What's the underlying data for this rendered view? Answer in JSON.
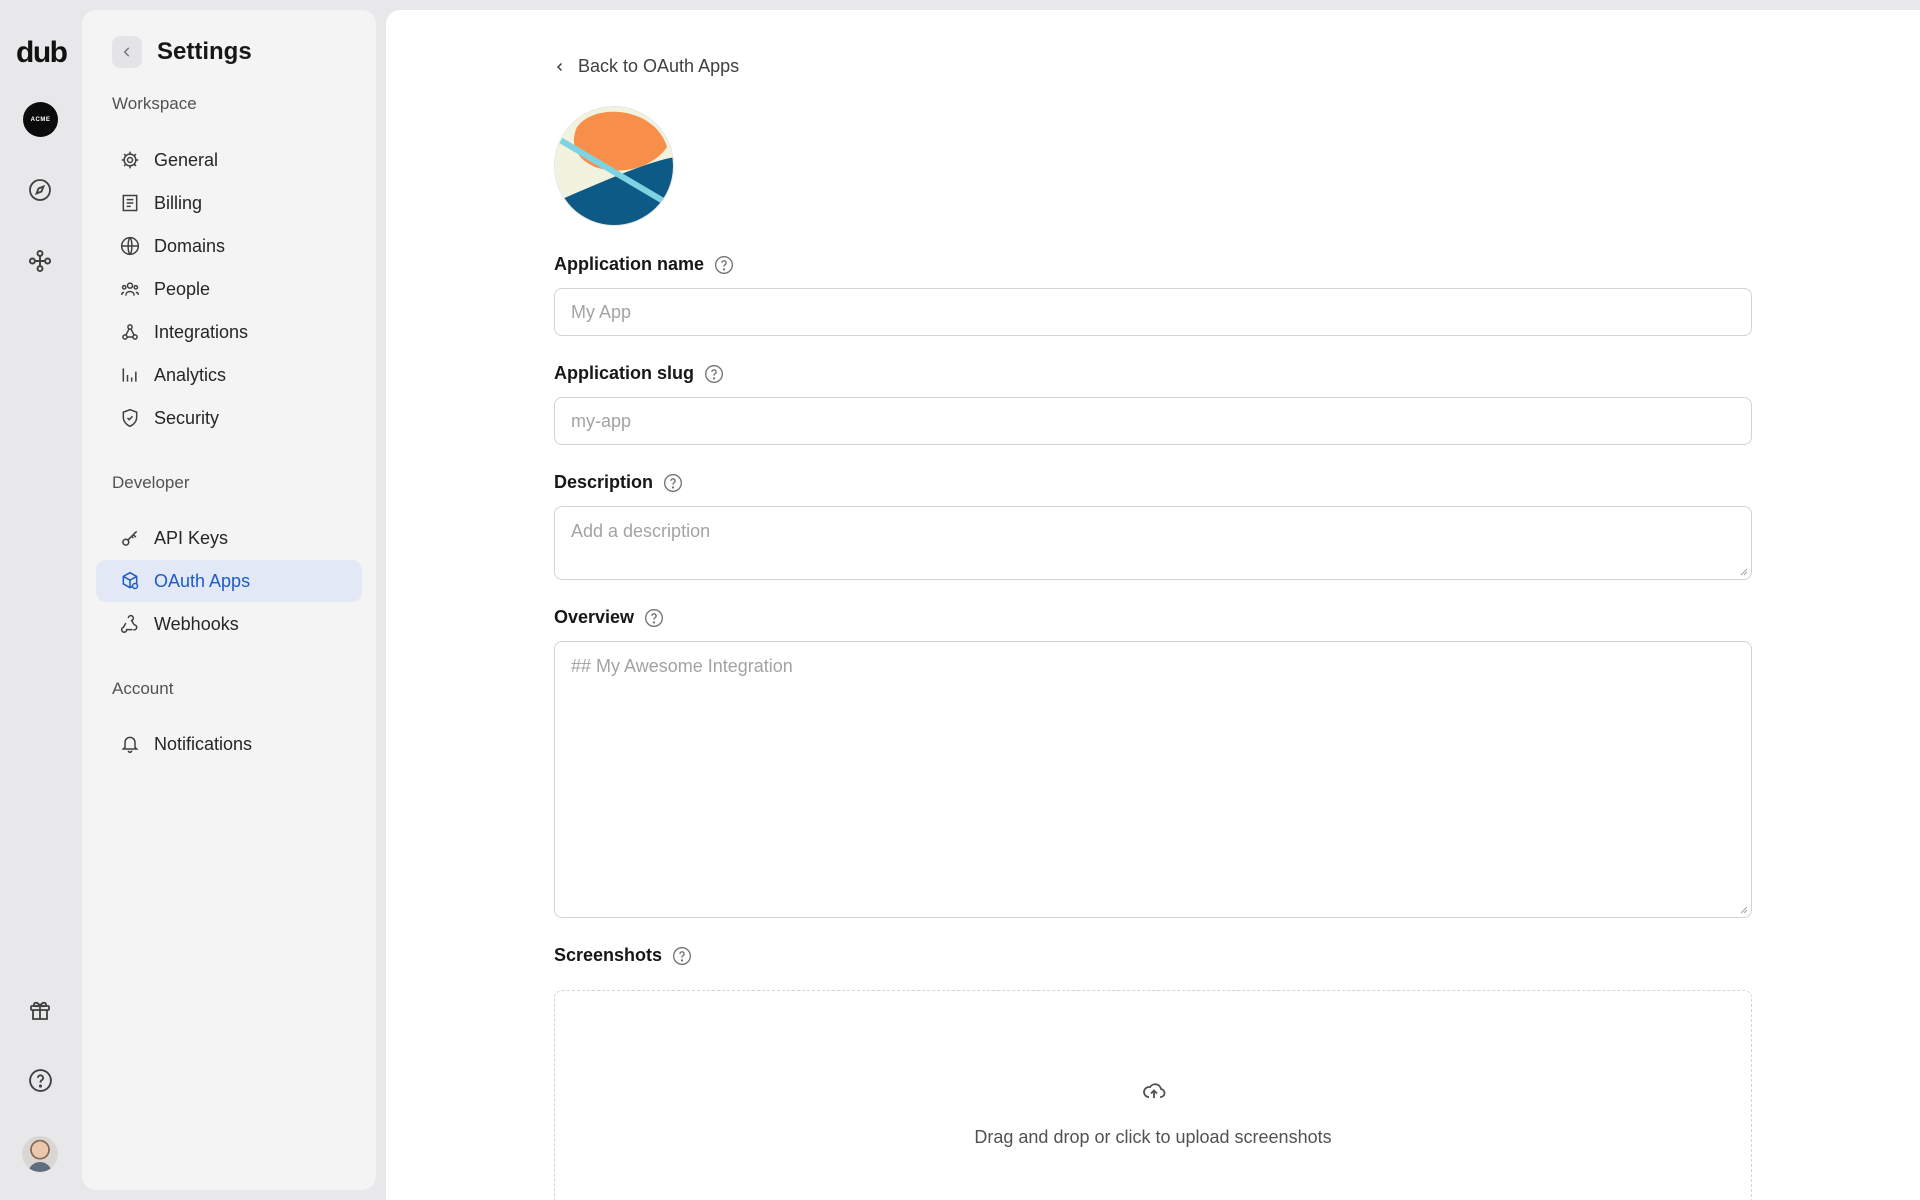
{
  "rail": {
    "logo": "dub",
    "workspace_avatar_text": "ACME"
  },
  "sidebar": {
    "title": "Settings",
    "sections": [
      {
        "label": "Workspace",
        "items": [
          {
            "label": "General",
            "icon": "gear-icon"
          },
          {
            "label": "Billing",
            "icon": "receipt-icon"
          },
          {
            "label": "Domains",
            "icon": "globe-icon"
          },
          {
            "label": "People",
            "icon": "users-icon"
          },
          {
            "label": "Integrations",
            "icon": "integrations-icon"
          },
          {
            "label": "Analytics",
            "icon": "bar-chart-icon"
          },
          {
            "label": "Security",
            "icon": "shield-icon"
          }
        ]
      },
      {
        "label": "Developer",
        "items": [
          {
            "label": "API Keys",
            "icon": "key-icon"
          },
          {
            "label": "OAuth Apps",
            "icon": "oauth-apps-icon",
            "active": true
          },
          {
            "label": "Webhooks",
            "icon": "webhook-icon"
          }
        ]
      },
      {
        "label": "Account",
        "items": [
          {
            "label": "Notifications",
            "icon": "bell-icon"
          }
        ]
      }
    ]
  },
  "main": {
    "back_link": "Back to OAuth Apps",
    "fields": {
      "app_name": {
        "label": "Application name",
        "placeholder": "My App"
      },
      "app_slug": {
        "label": "Application slug",
        "placeholder": "my-app"
      },
      "description": {
        "label": "Description",
        "placeholder": "Add a description"
      },
      "overview": {
        "label": "Overview",
        "placeholder": "## My Awesome Integration"
      },
      "screenshots": {
        "label": "Screenshots",
        "dropzone_text": "Drag and drop or click to upload screenshots"
      }
    }
  },
  "colors": {
    "accent": "#1d5bc7",
    "active_bg": "#e2e8f5",
    "logo_orange": "#f78f4b",
    "logo_blue": "#0c5a85",
    "logo_cream": "#f1f3de",
    "logo_cyan": "#7ed3e3"
  }
}
